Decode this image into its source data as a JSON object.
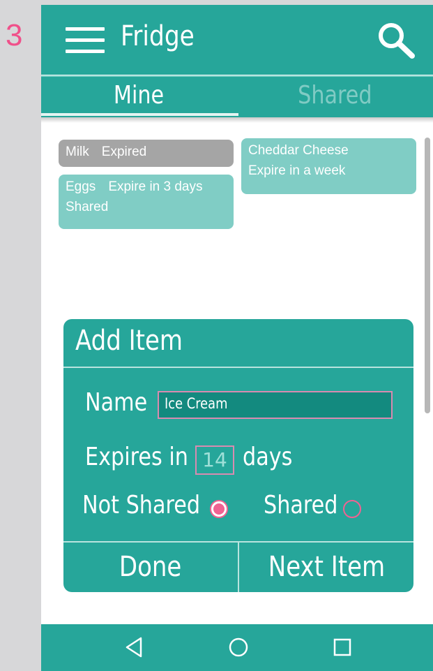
{
  "step_number": "3",
  "app_bar": {
    "title": "Fridge"
  },
  "tabs": [
    {
      "label": "Mine",
      "active": true
    },
    {
      "label": "Shared",
      "active": false
    }
  ],
  "items": [
    {
      "name": "Milk",
      "status": "Expired",
      "note": ""
    },
    {
      "name": "Eggs",
      "status": "Expire in 3 days",
      "note": "Shared"
    },
    {
      "name": "Cheddar Cheese",
      "status": "Expire in a week",
      "note": ""
    }
  ],
  "dialog": {
    "title": "Add Item",
    "name_label": "Name",
    "name_value": "Ice Cream",
    "expires_label": "Expires in",
    "expires_value": "14",
    "days_label": "days",
    "sharing_options": [
      {
        "label": "Not Shared",
        "selected": true
      },
      {
        "label": "Shared",
        "selected": false
      }
    ],
    "done_label": "Done",
    "next_label": "Next Item"
  },
  "icons": {
    "menu": "menu-icon",
    "search": "search-icon",
    "back": "back-icon",
    "home": "home-icon",
    "recents": "recents-icon"
  },
  "colors": {
    "primary": "#26a69a",
    "card_teal": "#80cdc5",
    "card_expired": "#a5a5a5",
    "accent": "#f06292",
    "step_number": "#f0508a"
  }
}
